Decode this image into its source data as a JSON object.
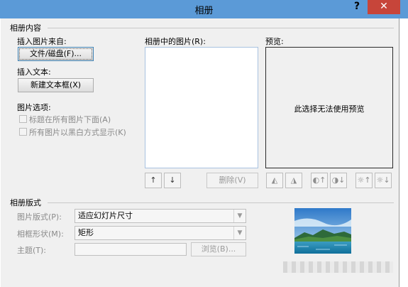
{
  "dialog": {
    "title": "相册",
    "help_icon": "?",
    "close_icon": "✕"
  },
  "album_content": {
    "section_label": "相册内容",
    "insert_picture_from_label": "插入图片来自:",
    "file_disk_button": "文件/磁盘(F)...",
    "insert_text_label": "插入文本:",
    "new_textbox_button": "新建文本框(X)",
    "picture_options_label": "图片选项:",
    "caption_below_label": "标题在所有图片下面(A)",
    "black_white_label": "所有图片以黑白方式显示(K)"
  },
  "pictures_list": {
    "label": "相册中的图片(R):"
  },
  "preview": {
    "label": "预览:",
    "no_preview_text": "此选择无法使用预览"
  },
  "list_actions": {
    "move_up_icon": "↑",
    "move_down_icon": "↓",
    "delete_button": "删除(V)"
  },
  "album_layout": {
    "section_label": "相册版式",
    "picture_layout_label": "图片版式(P):",
    "picture_layout_value": "适应幻灯片尺寸",
    "frame_shape_label": "相框形状(M):",
    "frame_shape_value": "矩形",
    "theme_label": "主题(T):",
    "theme_value": "",
    "browse_button": "浏览(B)..."
  }
}
